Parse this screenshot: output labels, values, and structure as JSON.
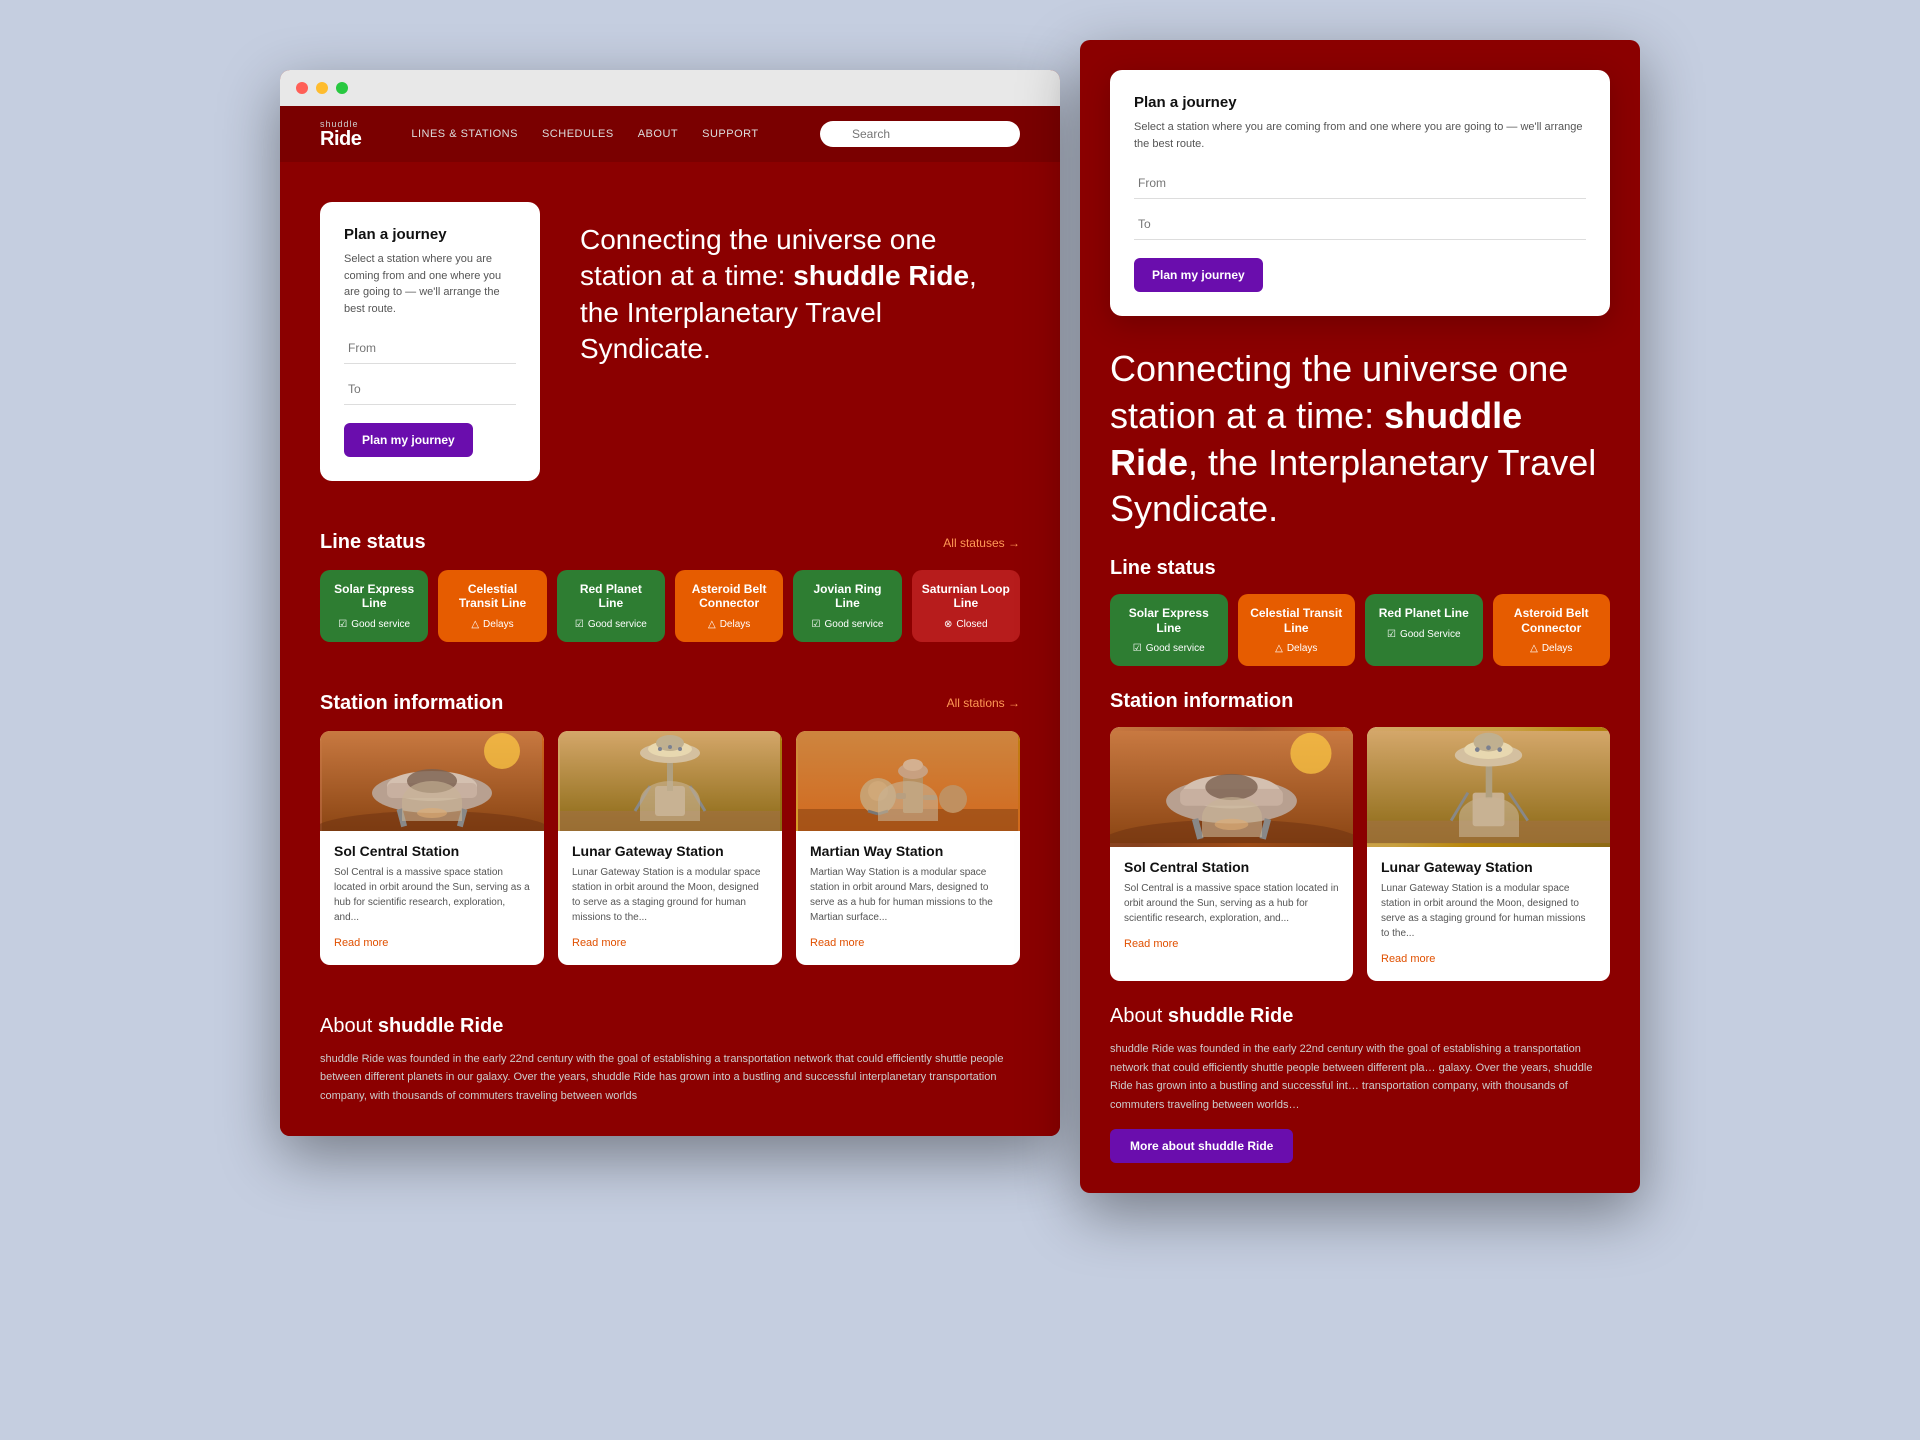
{
  "browser": {
    "dots": [
      "red",
      "yellow",
      "green"
    ]
  },
  "nav": {
    "logo_small": "shuddle",
    "logo_big": "Ride",
    "links": [
      "Lines & Stations",
      "Schedules",
      "About",
      "Support"
    ],
    "search_placeholder": "Search"
  },
  "hero": {
    "journey_card_title": "Plan a journey",
    "journey_card_desc": "Select a station where you are coming from and one where you are going to — we'll arrange the best route.",
    "from_label": "From",
    "to_label": "To",
    "plan_button": "Plan my journey",
    "headline": "Connecting the universe one station at a time: ",
    "headline_brand": "shuddle Ride",
    "headline_end": ", the Interplanetary Travel Syndicate."
  },
  "line_status": {
    "section_title": "Line status",
    "all_link": "All statuses →",
    "lines": [
      {
        "name": "Solar Express Line",
        "status": "Good service",
        "type": "green"
      },
      {
        "name": "Celestial Transit Line",
        "status": "Delays",
        "type": "orange"
      },
      {
        "name": "Red Planet Line",
        "status": "Good service",
        "type": "green"
      },
      {
        "name": "Asteroid Belt Connector",
        "status": "Delays",
        "type": "orange"
      },
      {
        "name": "Jovian Ring Line",
        "status": "Good service",
        "type": "green"
      },
      {
        "name": "Saturnian Loop Line",
        "status": "Closed",
        "type": "closed"
      }
    ]
  },
  "station_info": {
    "section_title": "Station information",
    "all_link": "All stations →",
    "stations": [
      {
        "name": "Sol Central Station",
        "desc": "Sol Central is a massive space station located in orbit around the Sun, serving as a hub for scientific research, exploration, and...",
        "read_more": "Read more"
      },
      {
        "name": "Lunar Gateway Station",
        "desc": "Lunar Gateway Station is a modular space station in orbit around the Moon, designed to serve as a staging ground for human missions to the...",
        "read_more": "Read more"
      },
      {
        "name": "Martian Way Station",
        "desc": "Martian Way Station is a modular space station in orbit around Mars, designed to serve as a hub for human missions to the Martian surface...",
        "read_more": "Read more"
      }
    ]
  },
  "about": {
    "title_prefix": "About ",
    "title_brand": "shuddle Ride",
    "text": "shuddle Ride was founded in the early 22nd century with the goal of establishing a transportation network that could efficiently shuttle people between different planets in our galaxy. Over the years, shuddle Ride has grown into a bustling and successful interplanetary transportation company, with thousands of commuters traveling between worlds"
  },
  "right_panel": {
    "hero_text": "Connecting the univer… time: ",
    "hero_brand": "shuddle Ride",
    "hero_end": ", th… Travel Syndicate.",
    "line_status_title": "Line status",
    "right_lines": [
      {
        "name": "Solar Express Line",
        "status": "Good service",
        "type": "green"
      },
      {
        "name": "Celestial Transit Line",
        "status": "Delays",
        "type": "orange"
      },
      {
        "name": "Red Planet Line",
        "status": "Good Service",
        "type": "green"
      },
      {
        "name": "Asteroid Belt Connector",
        "status": "Delays",
        "type": "orange"
      }
    ],
    "station_title": "Station information",
    "right_stations": [
      {
        "name": "Sol Central Station",
        "desc": "Sol Central is a massive space station located in orbit around the Sun, serving as a hub for scientific research, exploration, and...",
        "read_more": "Read more"
      },
      {
        "name": "Lunar Gateway Station",
        "desc": "Lunar Gateway Station is a modular space station in orbit around the Moon, designed to serve as a staging ground for human missions to the...",
        "read_more": "Read more"
      }
    ],
    "about_title_prefix": "About ",
    "about_brand": "shuddle Ride",
    "about_text": "shuddle Ride was founded in the early 22nd century with the goal of establishing a transportation network that could efficiently shuttle people between different pla… galaxy. Over the years, shuddle Ride has grown into a bustling and successful int… transportation company, with thousands of commuters traveling between worlds…",
    "more_button": "More about shuddle Ride"
  }
}
